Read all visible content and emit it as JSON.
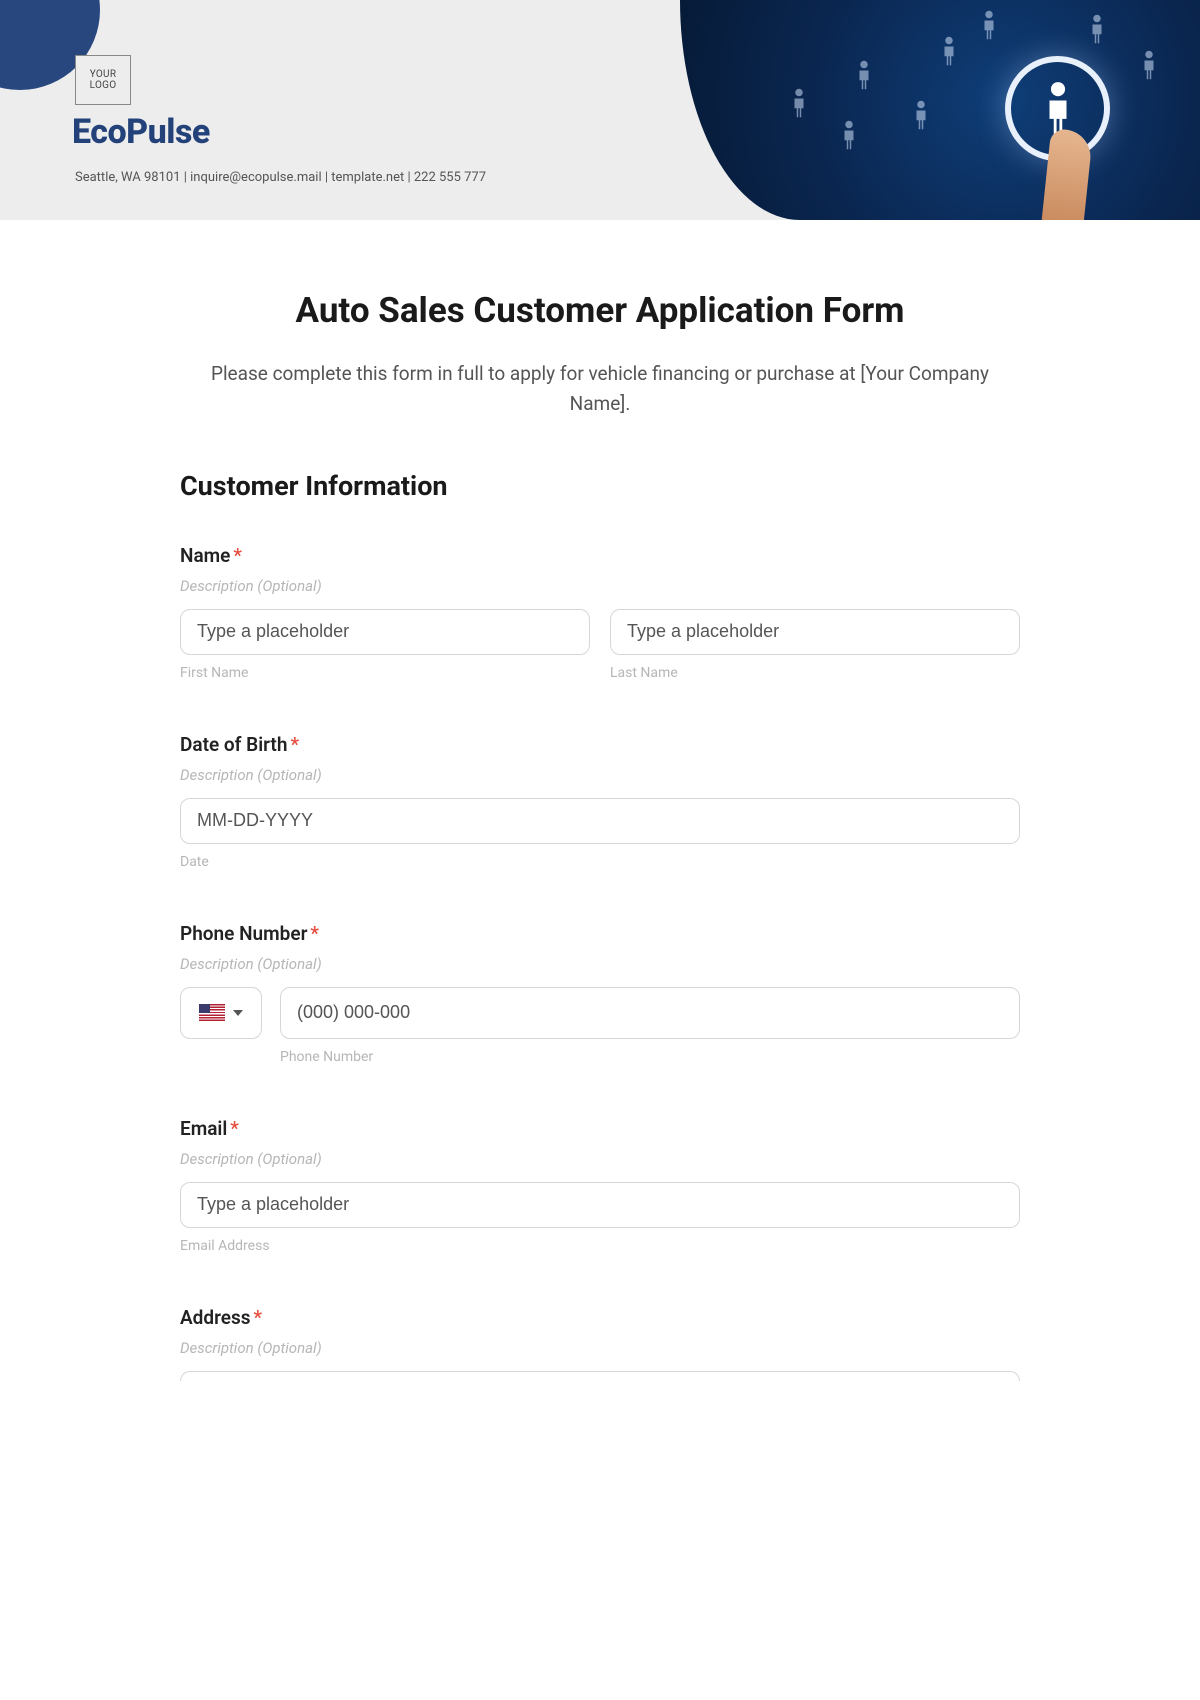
{
  "header": {
    "logo_text": "YOUR\nLOGO",
    "brand": "EcoPulse",
    "contact_line": "Seattle, WA 98101 | inquire@ecopulse.mail | template.net | 222 555 777"
  },
  "form": {
    "title": "Auto Sales Customer Application Form",
    "intro": "Please complete this form in full to apply for vehicle financing or purchase at [Your Company Name].",
    "section_heading": "Customer Information",
    "required_mark": "*",
    "description_placeholder": "Description (Optional)",
    "fields": {
      "name": {
        "label": "Name",
        "first_placeholder": "Type a placeholder",
        "last_placeholder": "Type a placeholder",
        "first_sub": "First Name",
        "last_sub": "Last Name"
      },
      "dob": {
        "label": "Date of Birth",
        "placeholder": "MM-DD-YYYY",
        "sub": "Date"
      },
      "phone": {
        "label": "Phone Number",
        "placeholder": "(000) 000-000",
        "sub": "Phone Number"
      },
      "email": {
        "label": "Email",
        "placeholder": "Type a placeholder",
        "sub": "Email Address"
      },
      "address": {
        "label": "Address"
      }
    }
  }
}
